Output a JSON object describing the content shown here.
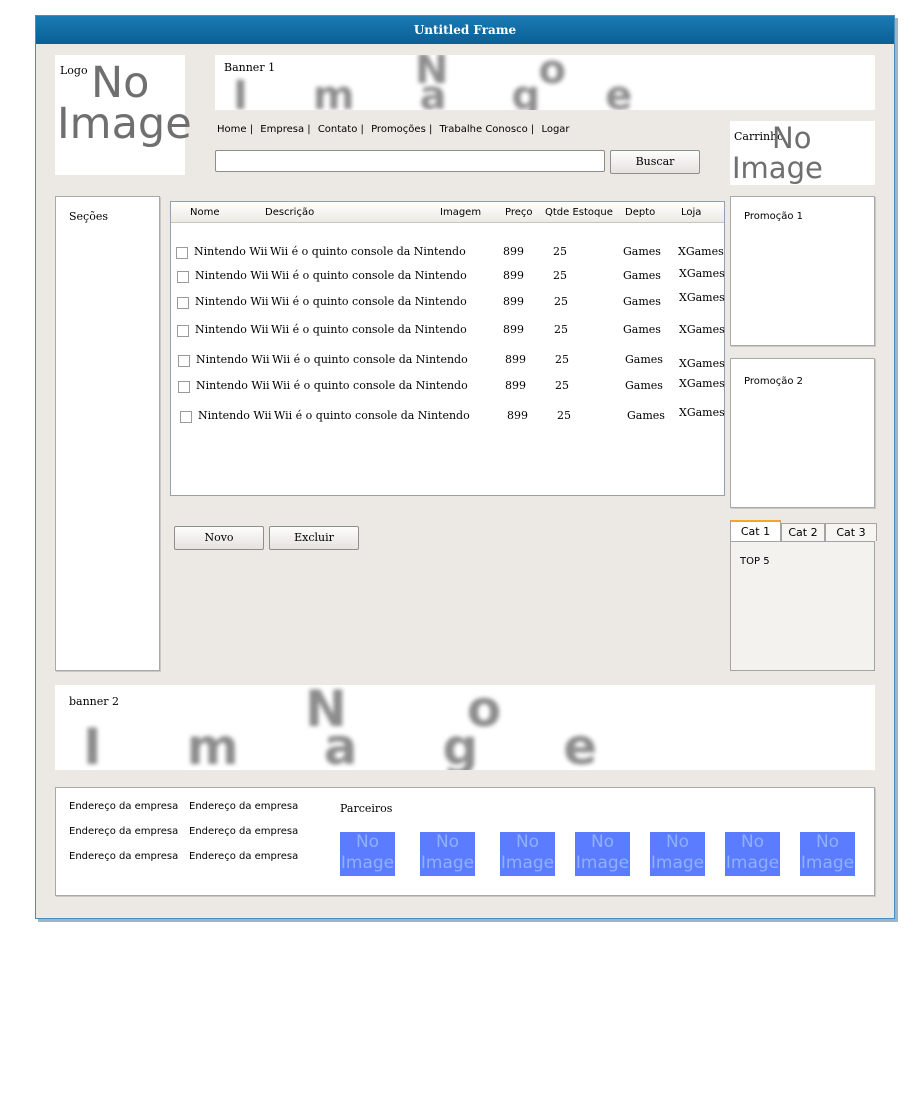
{
  "window": {
    "title": "Untitled Frame"
  },
  "logo": {
    "label": "Logo",
    "placeholder_line1": "No",
    "placeholder_line2": "Image"
  },
  "banner1": {
    "label": "Banner 1",
    "placeholder_line1": "No",
    "placeholder_line2": "Image"
  },
  "nav": {
    "items": [
      "Home |",
      "Empresa |",
      "Contato |",
      "Promoções |",
      "Trabalhe Conosco |",
      "Logar"
    ]
  },
  "search": {
    "value": "",
    "button_label": "Buscar"
  },
  "cart": {
    "label": "Carrinho",
    "placeholder_line1": "No",
    "placeholder_line2": "Image"
  },
  "sections": {
    "title": "Seções"
  },
  "table": {
    "headers": [
      "Nome",
      "Descrição",
      "Imagem",
      "Preço",
      "Qtde Estoque",
      "Depto",
      "Loja"
    ],
    "rows": [
      {
        "nome": "Nintendo Wii",
        "descricao": "Wii é o quinto console da Nintendo",
        "preco": "899",
        "qtde": "25",
        "depto": "Games",
        "loja": "XGames"
      },
      {
        "nome": "Nintendo Wii",
        "descricao": "Wii é o quinto console da Nintendo",
        "preco": "899",
        "qtde": "25",
        "depto": "Games",
        "loja": "XGames"
      },
      {
        "nome": "Nintendo Wii",
        "descricao": "Wii é o quinto console da Nintendo",
        "preco": "899",
        "qtde": "25",
        "depto": "Games",
        "loja": "XGames"
      },
      {
        "nome": "Nintendo Wii",
        "descricao": "Wii é o quinto console da Nintendo",
        "preco": "899",
        "qtde": "25",
        "depto": "Games",
        "loja": "XGames"
      },
      {
        "nome": "Nintendo Wii",
        "descricao": "Wii é o quinto console da Nintendo",
        "preco": "899",
        "qtde": "25",
        "depto": "Games",
        "loja": "XGames"
      },
      {
        "nome": "Nintendo Wii",
        "descricao": "Wii é o quinto console da Nintendo",
        "preco": "899",
        "qtde": "25",
        "depto": "Games",
        "loja": "XGames"
      },
      {
        "nome": "Nintendo Wii",
        "descricao": "Wii é o quinto console da Nintendo",
        "preco": "899",
        "qtde": "25",
        "depto": "Games",
        "loja": "XGames"
      }
    ]
  },
  "actions": {
    "new_label": "Novo",
    "delete_label": "Excluir"
  },
  "promo1": {
    "title": "Promoção 1"
  },
  "promo2": {
    "title": "Promoção 2"
  },
  "tabs": {
    "items": [
      "Cat 1",
      "Cat 2",
      "Cat 3"
    ],
    "active": 0,
    "content": "TOP 5"
  },
  "banner2": {
    "label": "banner 2",
    "placeholder_line1": "No",
    "placeholder_line2": "Image"
  },
  "footer": {
    "address": [
      "Endereço da empresa",
      "Endereço da empresa",
      "Endereço da empresa",
      "Endereço da empresa",
      "Endereço da empresa",
      "Endereço da empresa"
    ],
    "partners_title": "Parceiros",
    "partner_placeholder_line1": "No",
    "partner_placeholder_line2": "Image",
    "partners_count": 7
  },
  "colors": {
    "title_bar": "#0b6aa8",
    "frame_bg": "#ece9e4",
    "partner_logo": "#5b7cff",
    "tab_active": "#f5a623"
  }
}
